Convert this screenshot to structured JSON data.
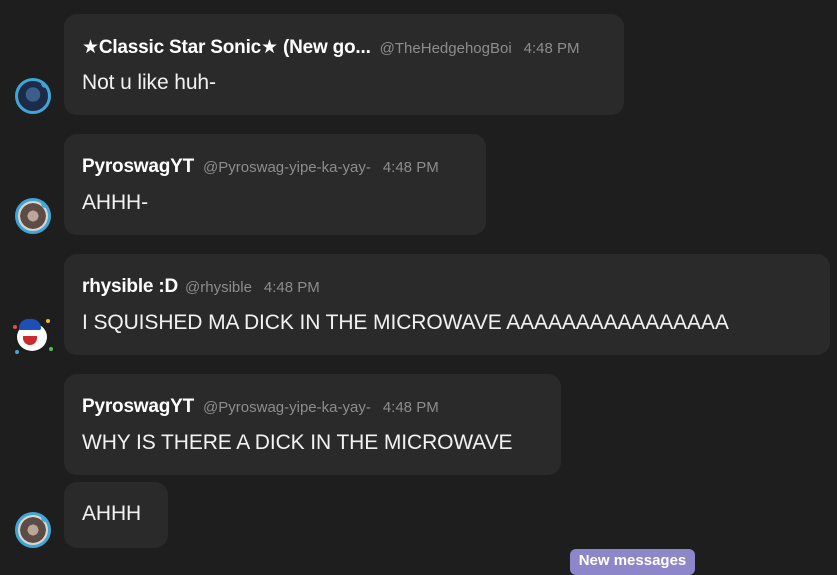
{
  "messages": [
    {
      "name": "★Classic Star Sonic★ (New go...",
      "handle": "@TheHedgehogBoi",
      "time": "4:48 PM",
      "text": "Not u like huh-"
    },
    {
      "name": "PyroswagYT",
      "handle": "@Pyroswag-yipe-ka-yay-",
      "time": "4:48 PM",
      "text": "AHHH-"
    },
    {
      "name": "rhysible :D",
      "handle": "@rhysible",
      "time": "4:48 PM",
      "text": "I SQUISHED MA DICK IN THE MICROWAVE AAAAAAAAAAAAAAAA"
    },
    {
      "name": "PyroswagYT",
      "handle": "@Pyroswag-yipe-ka-yay-",
      "time": "4:48 PM",
      "text": "WHY IS THERE A DICK IN THE MICROWAVE"
    },
    {
      "text": "AHHH"
    }
  ],
  "new_messages_label": "New messages",
  "colors": {
    "background": "#1e1e1f",
    "bubble": "#2a2a2b",
    "muted_text": "#8d8d8e",
    "avatar_ring": "#3fa6d8",
    "new_messages_pill": "#8d86c9"
  }
}
